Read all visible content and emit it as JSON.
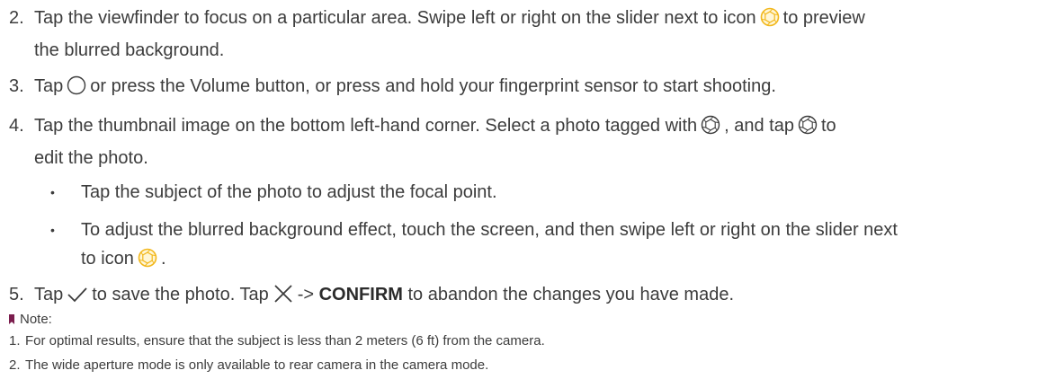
{
  "steps": [
    {
      "num": "2.",
      "part1": "Tap the viewfinder to focus on a particular area. Swipe left or right on the slider next to icon",
      "part2": "to preview",
      "line2": "the blurred background."
    },
    {
      "num": "3.",
      "part1": "Tap",
      "part2": "or press the Volume button, or press and hold your fingerprint sensor to start shooting."
    },
    {
      "num": "4.",
      "part1": "Tap the thumbnail image on the bottom left-hand corner. Select a photo tagged with",
      "part2": ", and tap",
      "part3": "to",
      "line2": "edit the photo."
    },
    {
      "num": "5.",
      "part1": "Tap",
      "part2": "to save the photo. Tap",
      "part3": "->",
      "confirm": "CONFIRM",
      "part4": "to abandon the changes you have made."
    }
  ],
  "bullets": [
    {
      "dot": "•",
      "text": "Tap the subject of the photo to adjust the focal point."
    },
    {
      "dot": "•",
      "line1": "To adjust the blurred background effect, touch the screen, and then swipe left or right on the slider next",
      "line2a": "to icon",
      "line2b": "."
    }
  ],
  "note": {
    "title": "Note:",
    "items": [
      {
        "num": "1.",
        "text": "For optimal results, ensure that the subject is less than 2 meters (6 ft) from the camera."
      },
      {
        "num": "2.",
        "text": "The wide aperture mode is only available to rear camera in the camera mode."
      }
    ]
  },
  "icons": {
    "aperture_yellow": "aperture-icon-yellow",
    "shutter": "shutter-circle-icon",
    "aperture_gray": "aperture-icon-gray",
    "check": "checkmark-icon",
    "close": "close-x-icon"
  },
  "colors": {
    "accent_yellow": "#f2b71b",
    "note_flag": "#7b1d4d",
    "text": "#3c3c3c"
  }
}
